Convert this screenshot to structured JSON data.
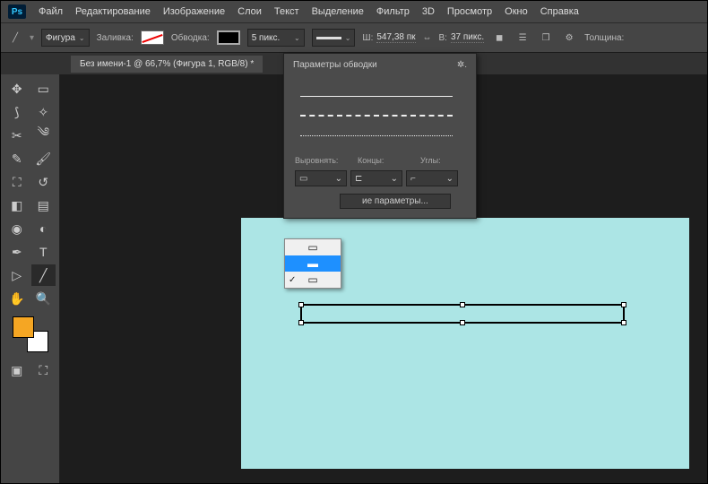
{
  "menu": {
    "items": [
      "Файл",
      "Редактирование",
      "Изображение",
      "Слои",
      "Текст",
      "Выделение",
      "Фильтр",
      "3D",
      "Просмотр",
      "Окно",
      "Справка"
    ]
  },
  "options": {
    "shape_label": "Фигура",
    "fill_label": "Заливка:",
    "stroke_label": "Обводка:",
    "stroke_width": "5 пикс.",
    "w_label": "Ш:",
    "w_value": "547,38 пк",
    "h_label": "В:",
    "h_value": "37 пикс.",
    "thickness_label": "Толщина:",
    "link_icon": "⇔"
  },
  "document": {
    "tab_title": "Без имени-1 @ 66,7% (Фигура 1, RGB/8) *"
  },
  "popup": {
    "title": "Параметры обводки",
    "align_label": "Выровнять:",
    "caps_label": "Концы:",
    "corners_label": "Углы:",
    "more_label": "ие параметры..."
  },
  "colors": {
    "canvas_bg": "#ace5e5",
    "foreground": "#f5a623",
    "background": "#ffffff"
  }
}
